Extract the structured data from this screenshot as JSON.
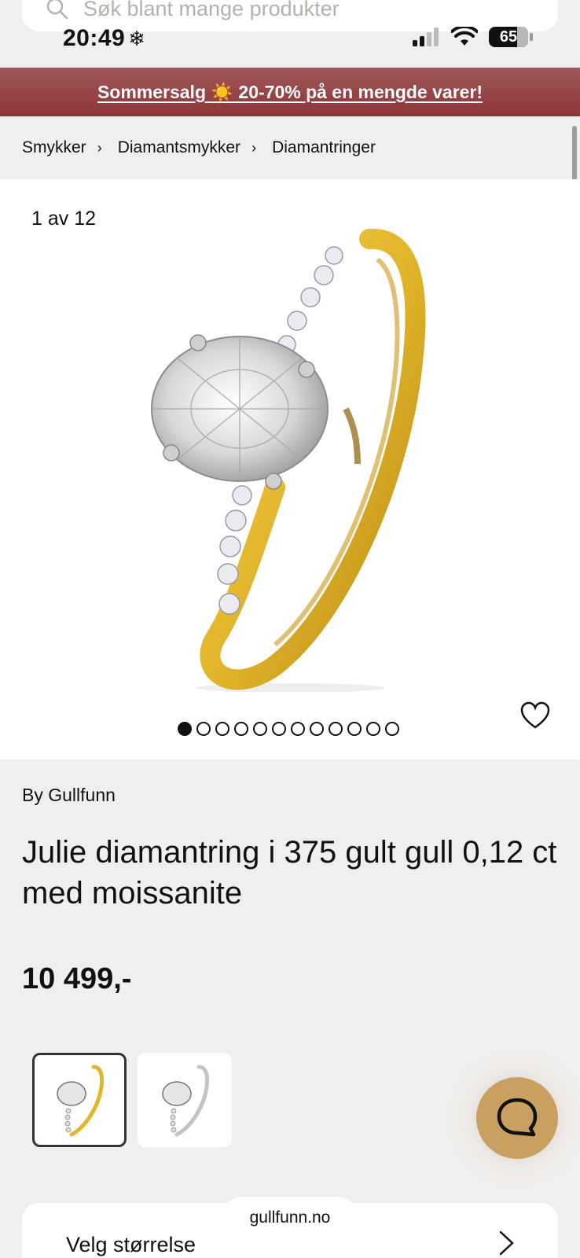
{
  "search": {
    "placeholder": "Søk blant mange produkter"
  },
  "status_bar": {
    "time": "20:49",
    "time_icon": "❄",
    "battery_level": "65"
  },
  "promo": {
    "text": "Sommersalg ☀️ 20-70% på en mengde varer!"
  },
  "breadcrumb": {
    "items": [
      {
        "label": "Smykker"
      },
      {
        "label": "Diamantsmykker"
      },
      {
        "label": "Diamantringer"
      }
    ],
    "separator": "›"
  },
  "gallery": {
    "counter": "1 av 12",
    "dots_total": 12,
    "dots_active": 1
  },
  "product": {
    "brand": "By Gullfunn",
    "title": "Julie diamantring i 375 gult gull 0,12 ct med moissanite",
    "price": "10 499,-"
  },
  "variants": [
    {
      "name": "gult gull",
      "selected": true
    },
    {
      "name": "hvitt gull",
      "selected": false
    }
  ],
  "size_selector": {
    "label": "Velg størrelse"
  },
  "browser": {
    "url": "gullfunn.no"
  },
  "colors": {
    "banner": "#8c3537",
    "chat_accent": "#c9a060",
    "gold": "#e2b52a",
    "background": "#f1efed"
  },
  "icons": [
    "search-icon",
    "snowflake-icon",
    "signal-icon",
    "wifi-icon",
    "battery-icon",
    "chevron-right-icon",
    "heart-icon",
    "chat-icon"
  ]
}
